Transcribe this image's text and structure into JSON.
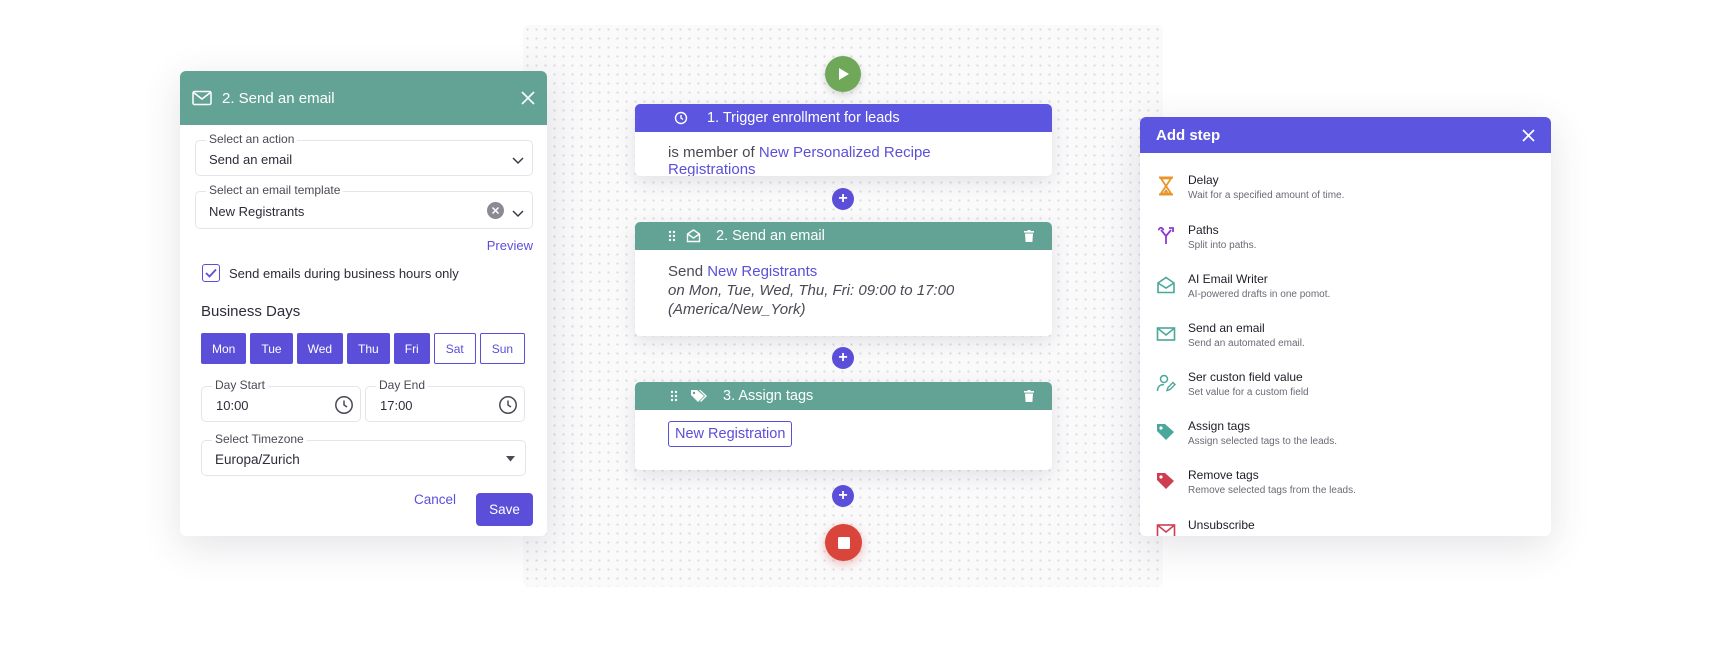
{
  "colors": {
    "purple": "#5b4fd9",
    "teal": "#62a396",
    "green": "#6fa858",
    "red": "#d9453b"
  },
  "flow": {
    "trigger": {
      "title": "1. Trigger enrollment for leads",
      "prefix": "is member of",
      "list": "New Personalized Recipe Registrations",
      "icon": "clock-icon"
    },
    "email": {
      "title": "2. Send an email",
      "send_word": "Send",
      "template": "New Registrants",
      "schedule_line1": "on Mon, Tue, Wed, Thu, Fri: 09:00 to 17:00",
      "schedule_line2": "(America/New_York)"
    },
    "tags": {
      "title": "3. Assign tags",
      "tag": "New Registration"
    },
    "plus": "+"
  },
  "editor": {
    "title": "2. Send an email",
    "action": {
      "label": "Select an action",
      "value": "Send an email"
    },
    "template": {
      "label": "Select an email template",
      "value": "New Registrants"
    },
    "preview": "Preview",
    "business_hours": {
      "label": "Send emails during business hours only",
      "checked": true
    },
    "business_days_title": "Business Days",
    "days": [
      {
        "label": "Mon",
        "on": true
      },
      {
        "label": "Tue",
        "on": true
      },
      {
        "label": "Wed",
        "on": true
      },
      {
        "label": "Thu",
        "on": true
      },
      {
        "label": "Fri",
        "on": true
      },
      {
        "label": "Sat",
        "on": false
      },
      {
        "label": "Sun",
        "on": false
      }
    ],
    "day_start": {
      "label": "Day Start",
      "value": "10:00"
    },
    "day_end": {
      "label": "Day End",
      "value": "17:00"
    },
    "timezone": {
      "label": "Select Timezone",
      "value": "Europa/Zurich"
    },
    "cancel": "Cancel",
    "save": "Save"
  },
  "add_step": {
    "title": "Add step",
    "items": [
      {
        "title": "Delay",
        "desc": "Wait for a specified amount of time.",
        "icon": "hourglass-icon"
      },
      {
        "title": "Paths",
        "desc": "Split into paths.",
        "icon": "split-paths-icon"
      },
      {
        "title": "AI Email Writer",
        "desc": "AI-powered drafts in one pomot.",
        "icon": "ai-envelope-icon"
      },
      {
        "title": "Send an email",
        "desc": "Send an automated email.",
        "icon": "envelope-icon"
      },
      {
        "title": "Ser custon field value",
        "desc": "Set value for a custom field",
        "icon": "user-edit-icon"
      },
      {
        "title": "Assign tags",
        "desc": "Assign selected tags to the leads.",
        "icon": "tag-icon"
      },
      {
        "title": "Remove tags",
        "desc": "Remove selected tags from the leads.",
        "icon": "tag-remove-icon"
      },
      {
        "title": "Unsubscribe",
        "desc": "",
        "icon": "unsubscribe-icon"
      }
    ]
  }
}
